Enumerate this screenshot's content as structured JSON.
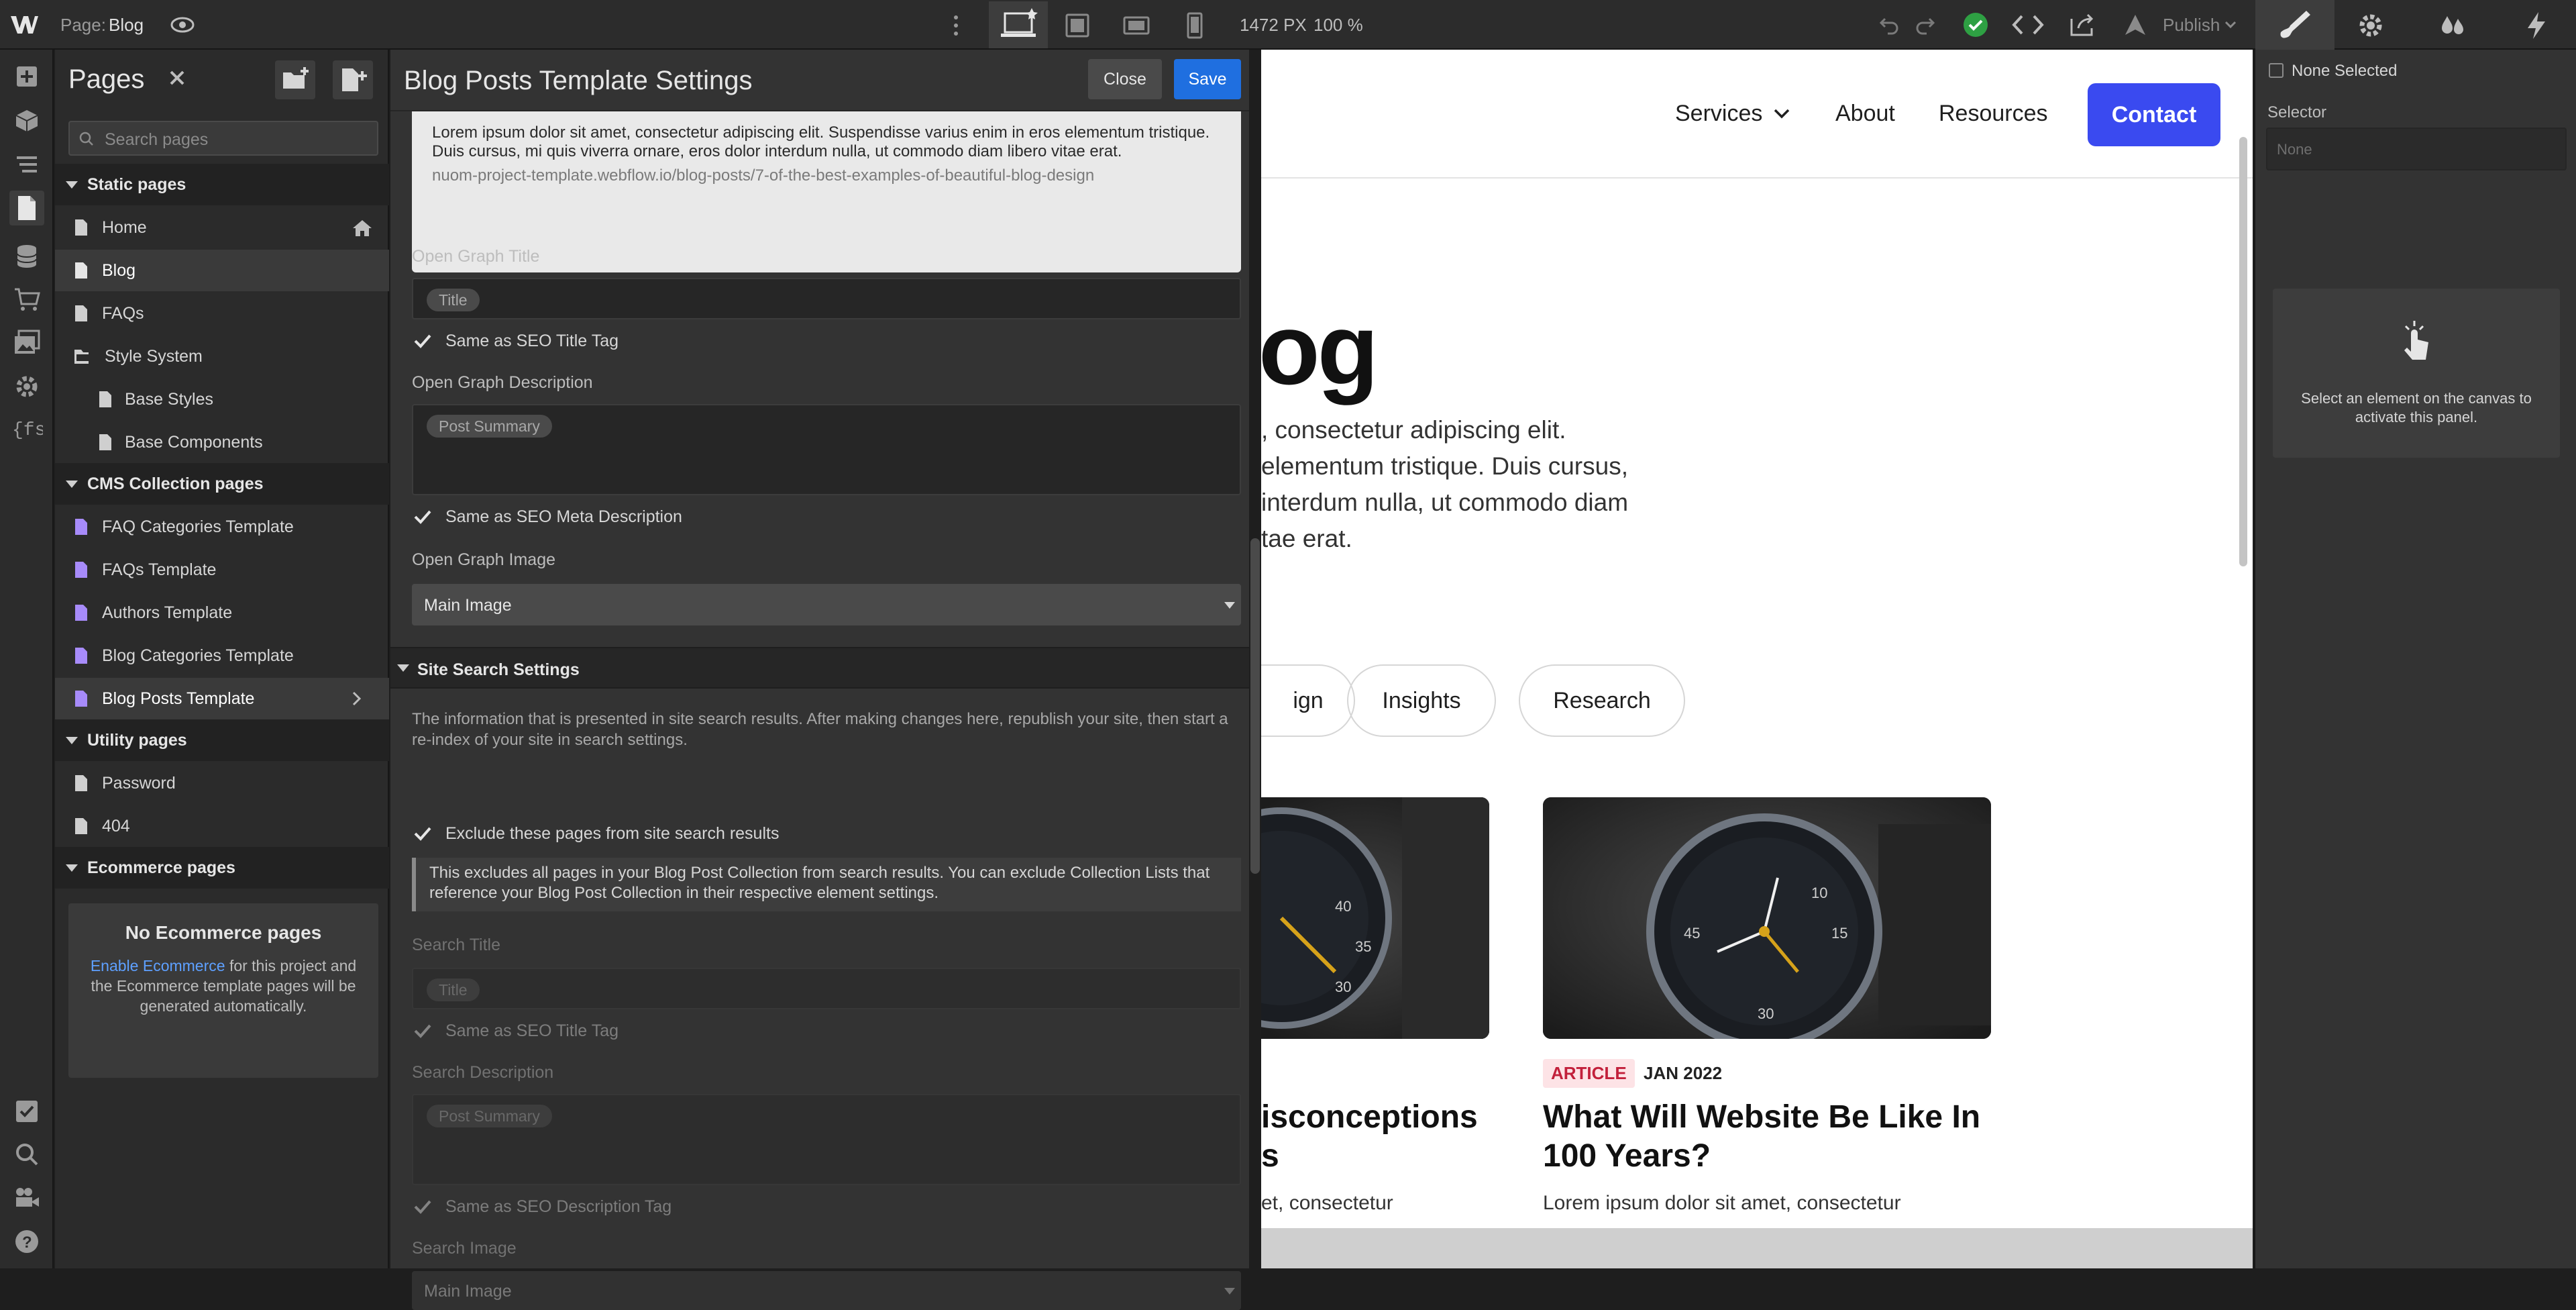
{
  "topbar": {
    "page_prefix": "Page:",
    "page_name": "Blog",
    "width_readout": "1472 PX",
    "zoom_readout": "100 %",
    "publish_label": "Publish"
  },
  "pages_panel": {
    "title": "Pages",
    "search_placeholder": "Search pages",
    "static_header": "Static pages",
    "static_items": [
      "Home",
      "Blog",
      "FAQs",
      "Style System",
      "Base Styles",
      "Base Components"
    ],
    "cms_header": "CMS Collection pages",
    "cms_items": [
      "FAQ Categories Template",
      "FAQs Template",
      "Authors Template",
      "Blog Categories Template",
      "Blog Posts Template"
    ],
    "utility_header": "Utility pages",
    "utility_items": [
      "Password",
      "404"
    ],
    "ecommerce_header": "Ecommerce pages",
    "ecommerce_empty_title": "No Ecommerce pages",
    "ecommerce_link": "Enable Ecommerce",
    "ecommerce_text": "for this project and the Ecommerce template pages will be generated automatically."
  },
  "settings_panel": {
    "title": "Blog Posts Template Settings",
    "close_label": "Close",
    "save_label": "Save",
    "preview_text": "Lorem ipsum dolor sit amet, consectetur adipiscing elit. Suspendisse varius enim in eros elementum tristique. Duis cursus, mi quis viverra ornare, eros dolor interdum nulla, ut commodo diam libero vitae erat.",
    "preview_url": "nuom-project-template.webflow.io/blog-posts/7-of-the-best-examples-of-beautiful-blog-design",
    "og_title_label": "Open Graph Title",
    "og_title_pill": "Title",
    "og_title_same": "Same as SEO Title Tag",
    "og_desc_label": "Open Graph Description",
    "og_desc_pill": "Post Summary",
    "og_desc_same": "Same as SEO Meta Description",
    "og_image_label": "Open Graph Image",
    "og_image_value": "Main Image",
    "site_search_header": "Site Search Settings",
    "site_search_info": "The information that is presented in site search results. After making changes here, republish your site, then start a re-index of your site in search settings.",
    "exclude_label": "Exclude these pages from site search results",
    "exclude_note": "This excludes all pages in your Blog Post Collection from search results. You can exclude Collection Lists that reference your Blog Post Collection in their respective element settings.",
    "search_title_label": "Search Title",
    "search_title_pill": "Title",
    "search_title_same": "Same as SEO Title Tag",
    "search_desc_label": "Search Description",
    "search_desc_pill": "Post Summary",
    "search_desc_same": "Same as SEO Description Tag",
    "search_image_label": "Search Image",
    "search_image_value": "Main Image"
  },
  "canvas": {
    "nav": {
      "services": "Services",
      "about": "About",
      "resources": "Resources",
      "contact": "Contact"
    },
    "hero_title_partial": "og",
    "hero_lines": [
      ", consectetur adipiscing elit.",
      "elementum tristique. Duis cursus,",
      "interdum nulla, ut commodo diam",
      "tae erat."
    ],
    "chips": [
      "ign",
      "Insights",
      "Research"
    ],
    "card_left": {
      "title_l1": "isconceptions",
      "title_l2": "s",
      "excerpt": "et, consectetur"
    },
    "card_right": {
      "tag": "ARTICLE",
      "date": "JAN 2022",
      "title_l1": "What Will Website Be Like In",
      "title_l2": "100 Years?",
      "excerpt": "Lorem ipsum dolor sit amet, consectetur"
    }
  },
  "right_panel": {
    "none_selected": "None Selected",
    "selector_label": "Selector",
    "selector_placeholder": "None",
    "empty_hint": "Select an element on the canvas to activate this panel."
  },
  "colors": {
    "accent_blue": "#3a4af0",
    "save_blue": "#1f6fe0",
    "check_green": "#2ea043",
    "cms_purple": "#a78bfa",
    "tag_red": "#c2203b"
  }
}
